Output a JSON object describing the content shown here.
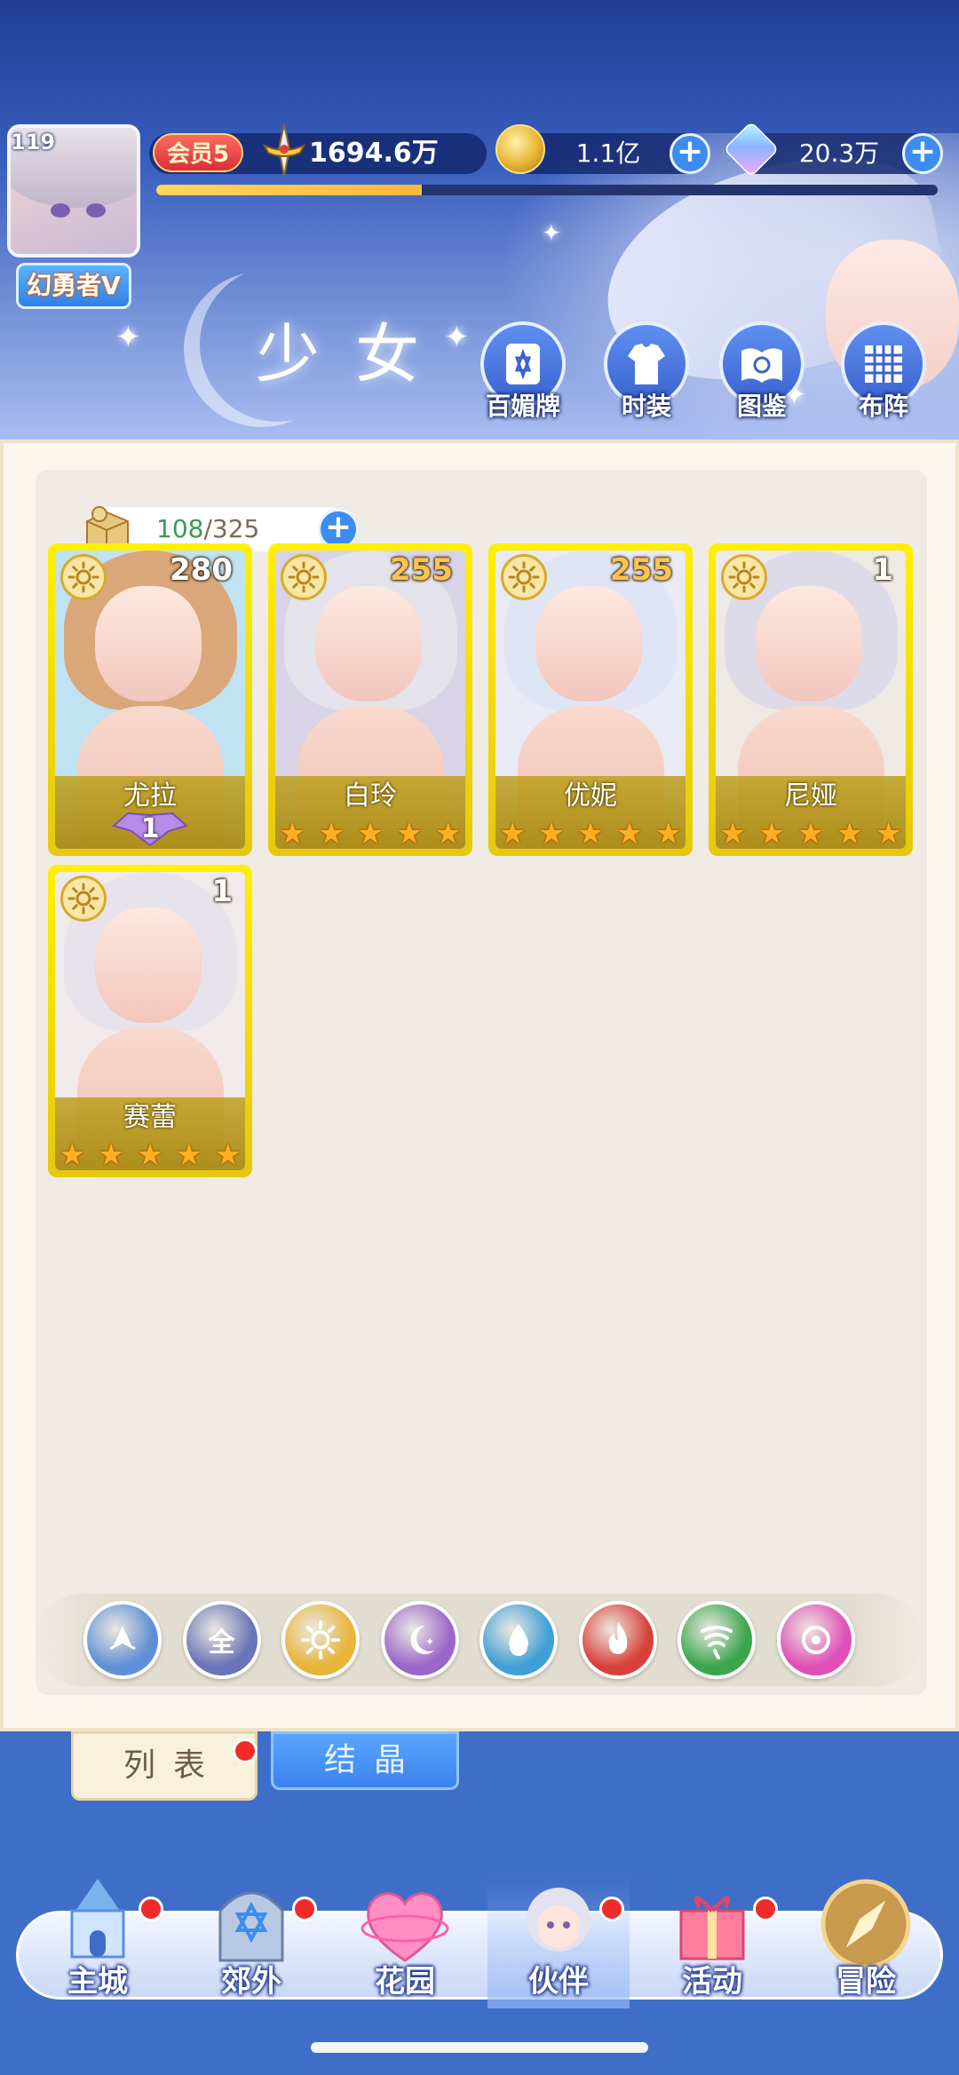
{
  "header": {
    "player_level": "119",
    "player_name": "幻勇者V",
    "vip_label": "会员5",
    "power_value": "1694.6万",
    "power_progress": 0.34,
    "gold_value": "1.1亿",
    "gem_value": "20.3万",
    "page_title": "少女",
    "nav": [
      {
        "label": "百媚牌",
        "icon": "card-deck-icon"
      },
      {
        "label": "时装",
        "icon": "outfit-icon"
      },
      {
        "label": "图鉴",
        "icon": "book-icon"
      },
      {
        "label": "布阵",
        "icon": "formation-grid-icon"
      }
    ]
  },
  "inventory": {
    "current": "108",
    "separator": "/",
    "max": "325"
  },
  "cards": [
    {
      "name": "尤拉",
      "level": "280",
      "level_color": "white",
      "element": "light",
      "stars": 0,
      "rank": "1",
      "hair": "#d9a77a",
      "bg": "#bfe3f2"
    },
    {
      "name": "白玲",
      "level": "255",
      "level_color": "gold",
      "element": "light",
      "stars": 5,
      "rank": "",
      "hair": "#e4e2ea",
      "bg": "#d8d3e6"
    },
    {
      "name": "优妮",
      "level": "255",
      "level_color": "gold",
      "element": "light",
      "stars": 5,
      "rank": "",
      "hair": "#dfe5f5",
      "bg": "#e9eaf3"
    },
    {
      "name": "尼娅",
      "level": "1",
      "level_color": "white",
      "element": "light",
      "stars": 5,
      "rank": "",
      "hair": "#dedbe8",
      "bg": "#efe9e4"
    },
    {
      "name": "赛蕾",
      "level": "1",
      "level_color": "white",
      "element": "light",
      "stars": 5,
      "rank": "",
      "hair": "#e7e3ea",
      "bg": "#f0eaea"
    }
  ],
  "filters": [
    {
      "name": "filter-wind-icon",
      "label": "",
      "color": "#5f8fd6"
    },
    {
      "name": "filter-all",
      "label": "全",
      "color": "#6a74b8"
    },
    {
      "name": "filter-light-icon",
      "label": "",
      "color": "#e8b43a"
    },
    {
      "name": "filter-dark-icon",
      "label": "",
      "color": "#9a66c9"
    },
    {
      "name": "filter-water-icon",
      "label": "",
      "color": "#3f9fd6"
    },
    {
      "name": "filter-fire-icon",
      "label": "",
      "color": "#d8413a"
    },
    {
      "name": "filter-nature-icon",
      "label": "",
      "color": "#3aa64e"
    },
    {
      "name": "filter-spirit-icon",
      "label": "",
      "color": "#df4fb6"
    }
  ],
  "tabs": {
    "list_label": "列表",
    "crystal_label": "结晶"
  },
  "bottom_nav": [
    {
      "label": "主城",
      "badge": true
    },
    {
      "label": "郊外",
      "badge": true
    },
    {
      "label": "花园",
      "badge": false
    },
    {
      "label": "伙伴",
      "badge": true,
      "active": true
    },
    {
      "label": "活动",
      "badge": true
    },
    {
      "label": "冒险",
      "badge": false
    }
  ]
}
